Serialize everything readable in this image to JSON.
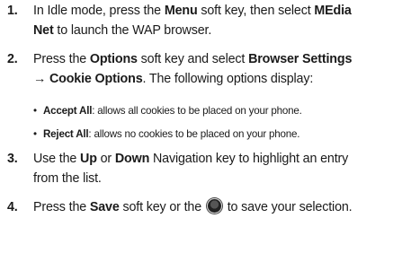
{
  "steps": [
    {
      "num": "1.",
      "line1": [
        "In Idle mode, press the ",
        "Menu",
        " soft key, then select ",
        "MEdia"
      ],
      "line2": [
        "Net",
        " to launch the WAP browser."
      ]
    },
    {
      "num": "2.",
      "line1": [
        "Press the ",
        "Options",
        " soft key and select ",
        "Browser Settings"
      ],
      "line2": [
        "→ Cookie Options",
        ". The following options display:"
      ]
    },
    {
      "num": "3.",
      "line1": [
        "Use the ",
        "Up",
        " or ",
        "Down",
        " Navigation key to highlight an entry"
      ],
      "line2": [
        "from the list."
      ]
    },
    {
      "num": "4.",
      "line1": [
        "Press the ",
        "Save",
        " soft key or the ",
        " to save your selection."
      ],
      "icon": "ok-key-icon"
    }
  ],
  "bullets": [
    {
      "dot": "•",
      "term": "Accept All",
      "desc": ": allows all cookies to be placed on your phone."
    },
    {
      "dot": "•",
      "term": "Reject All",
      "desc": ": allows no cookies to be placed on your phone."
    }
  ]
}
